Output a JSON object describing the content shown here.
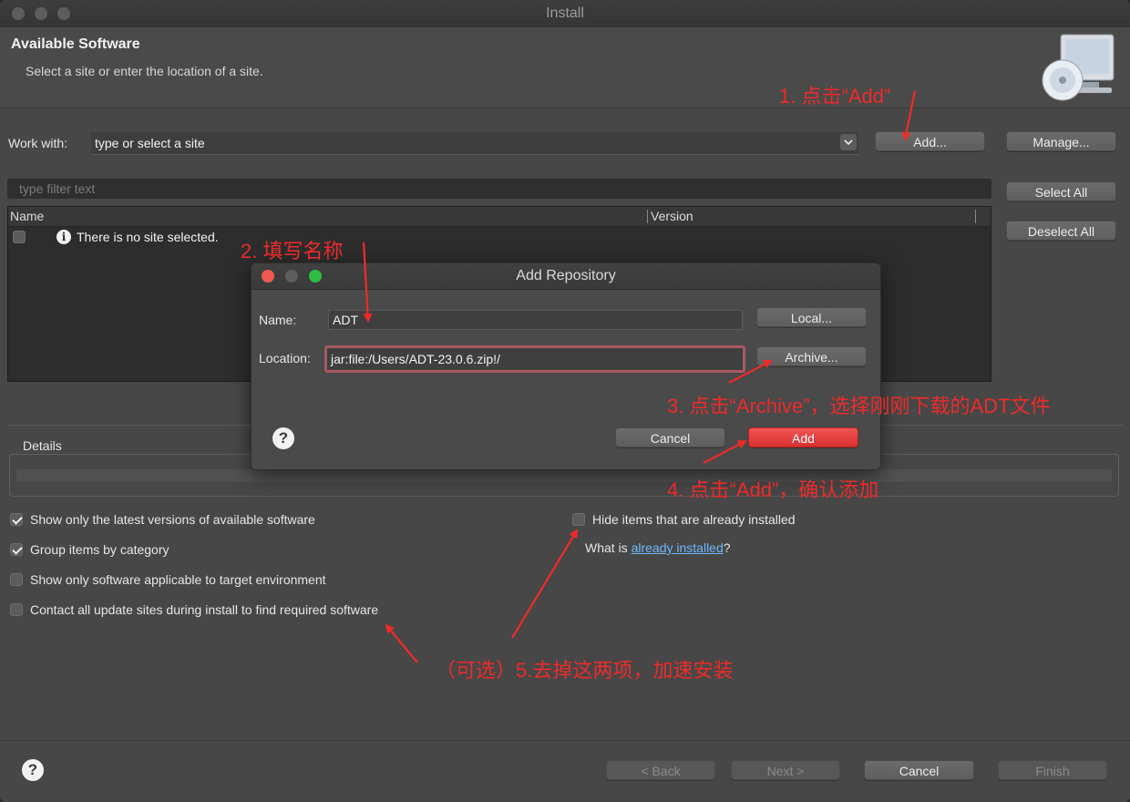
{
  "window": {
    "title": "Install"
  },
  "header": {
    "title": "Available Software",
    "subtitle": "Select a site or enter the location of a site."
  },
  "work_with": {
    "label": "Work with:",
    "value": "type or select a site",
    "add_button": "Add...",
    "manage_button": "Manage..."
  },
  "filter": {
    "placeholder": "type filter text"
  },
  "side_buttons": {
    "select_all": "Select All",
    "deselect_all": "Deselect All"
  },
  "table": {
    "columns": [
      "Name",
      "Version"
    ],
    "rows": [
      {
        "name": "There is no site selected.",
        "checked": false
      }
    ]
  },
  "details": {
    "label": "Details"
  },
  "options": {
    "latest_versions": {
      "label": "Show only the latest versions of available software",
      "checked": true
    },
    "group_by_category": {
      "label": "Group items by category",
      "checked": true
    },
    "applicable_only": {
      "label": "Show only software applicable to target environment",
      "checked": false
    },
    "contact_all_sites": {
      "label": "Contact all update sites during install to find required software",
      "checked": false
    },
    "hide_installed": {
      "label": "Hide items that are already installed",
      "checked": false
    },
    "what_is_prefix": "What is",
    "what_is_link": "already installed",
    "what_is_suffix": "?"
  },
  "footer": {
    "back": "< Back",
    "next": "Next >",
    "cancel": "Cancel",
    "finish": "Finish"
  },
  "dialog": {
    "title": "Add Repository",
    "name_label": "Name:",
    "name_value": "ADT",
    "location_label": "Location:",
    "location_value": "jar:file:/Users/ADT-23.0.6.zip!/",
    "local_button": "Local...",
    "archive_button": "Archive...",
    "cancel_button": "Cancel",
    "add_button": "Add"
  },
  "annotations": {
    "step1": "1. 点击“Add”",
    "step2": "2. 填写名称",
    "step3": "3. 点击“Archive”，选择刚刚下载的ADT文件",
    "step4": "4. 点击“Add”，确认添加",
    "step5": "（可选）5.去掉这两项，加速安装",
    "color": "#ee2b2b"
  },
  "colors": {
    "window_bg": "#474747",
    "add_button": "#e63b3b",
    "link": "#6fb6ff",
    "annotation": "#ee2b2b"
  }
}
